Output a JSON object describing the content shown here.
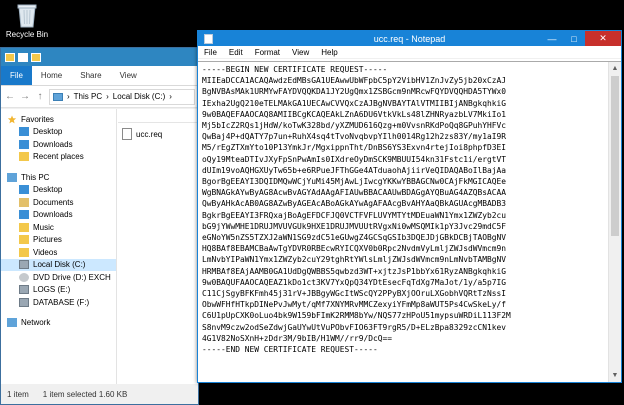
{
  "desktop": {
    "recycle_bin_label": "Recycle Bin"
  },
  "explorer": {
    "ribbon_tabs": [
      "File",
      "Home",
      "Share",
      "View"
    ],
    "address": {
      "root": "This PC",
      "drive": "Local Disk (C:)"
    },
    "nav": {
      "favorites": "Favorites",
      "fav_items": [
        "Desktop",
        "Downloads",
        "Recent places"
      ],
      "this_pc": "This PC",
      "pc_items": [
        "Desktop",
        "Documents",
        "Downloads",
        "Music",
        "Pictures",
        "Videos",
        "Local Disk (C:)",
        "DVD Drive (D:) EXCH",
        "LOGS (E:)",
        "DATABASE (F:)"
      ],
      "network": "Network"
    },
    "file_name": "ucc.req",
    "status": {
      "items": "1 item",
      "selected": "1 item selected  1.60 KB"
    }
  },
  "notepad": {
    "title": "ucc.req - Notepad",
    "menu": [
      "File",
      "Edit",
      "Format",
      "View",
      "Help"
    ],
    "content": "-----BEGIN NEW CERTIFICATE REQUEST-----\nMIIEaDCCA1ACAQAwdzEdMBsGA1UEAwwUbWFpbC5pY2VibHV1ZnJvZy5jb20xCzAJ\nBgNVBAsMAk1URMYwFAYDVQQKDA1JY2UgQmx1ZSBGcm9nMRcwFQYDVQQHDA5TYWx0\nIExha2UgQ210eTELMAkGA1UECAwCVVQxCzAJBgNVBAYTAlVTMIIBIjANBgkqhkiG\n9w0BAQEFAAOCAQ8AMIIBCgKCAQEAkLZnA6DU6VtkVkLs48lZHNRyazbLV7MkiIo1\nMj5bIcZ2RQs1jHdW/koTwK328bd/yXZMUD616Qzg+m0VvsnRKdPoQq8GPuhYHFVc\nQwBaj4P+dQATY7p7un+RuhX4sq4tTvoNvqbvpYIlh0014Rg12h2zs83Y/my1aI9R\nM5/rEgZTXmYto10P13YmkJr/MgxippnTht/DnBS6YS3Exvn4rtejIoi8phpfD3EI\noQy19MteaDTIvJXyFpSnPwAmIs0IXdreOyDmSCK9MBUUI54kn31Fstc1i/ergtVT\ndUIm19voAQHGXUyTw65b+e6RPueJFThGGe4ATduaohAjiirVeQIDAQABoIlBajAa\nBgorBgEEAYI3DQIDMQwWCjYuMi45MjAwLjIwcgYKKwYBBAGCNw0CAjFkMGICAQEe\nWgBNAGkAYwByAG8AcwBvAGYAdAAgAFIAUwBBACAAUwBDAGgAYQBuAG4AZQBsACAA\nQwByAHkAcAB0AG8AZwByAGEAcABoAGkAYwAgAFAAcgBvAHYAaQBkAGUAcgMBADB3\nBgkrBgEEAYI3FRQxajBoAgEFDCFJQ0VCTFVFLUVYMTYtMDEuaWN1Ymx1ZWZyb2cu\nbG9jYWwMHE1DRUJMVUVGUk9HXE1DRUJMVUUtRVgxNi0wMSQMIk1pY3Jvc29mdC5F\neGNoYW5nZS5TZXJ2aWN1SG9zdC51eGUwgZ4GCSqGSIb3DQEJDjGBkDCBjTAOBgNV\nHQ8BAf8EBAMCBaAwTgYDVR0RBEcwRYICQXV0b0Rpc2NvdmVyLmljZWJsdWVmcm9n\nLmNvbYIPaWN1Ymx1ZWZyb2cuY29tghRtYWlsLmljZWJsdWVmcm9nLmNvbTAMBgNV\nHRMBAf8EAjAAMB0GA1UdDgQWBBS5qwbzd3WT+xjtzJsP1bbYx61RyzANBgkqhkiG\n9w0BAQUFAAOCAQEAZ1kDo1ct3KV7YxQpQ34YDtEsecFqTdXg7MaJot/1y/a5p7IG\nC11CjSgyBFKFmh45j31rV+JBBgyWGcItWScQY2PPyBXjOOruLXGobhVQRtTzNssI\nObwWFHfHTkpDINePvJwMyt/qMf7XNYMRvMMCZexyiYFmMp8aWUT5Ps4CwSkeLy/f\nC6U1pUpCXK0oLuo4bk9W159bFImK2RMM8bYw/NQS77zHPoU51mypsuWRDiL113F2M\nS8nvM9czw2odSeZdwjGaUYwUtVuPObvFIO63FT9rgR5/D+ELzBpa8329zcCN1kev\n4G1V82NoSXnH+zDdr3M/9bIB/H1WM//rr9/DcQ==\n-----END NEW CERTIFICATE REQUEST-----"
  },
  "colors": {
    "titlebar_blue": "#1883d7",
    "close_red": "#c7302b",
    "ribbon_file": "#1979ca",
    "folder_yellow": "#f3c84b"
  }
}
